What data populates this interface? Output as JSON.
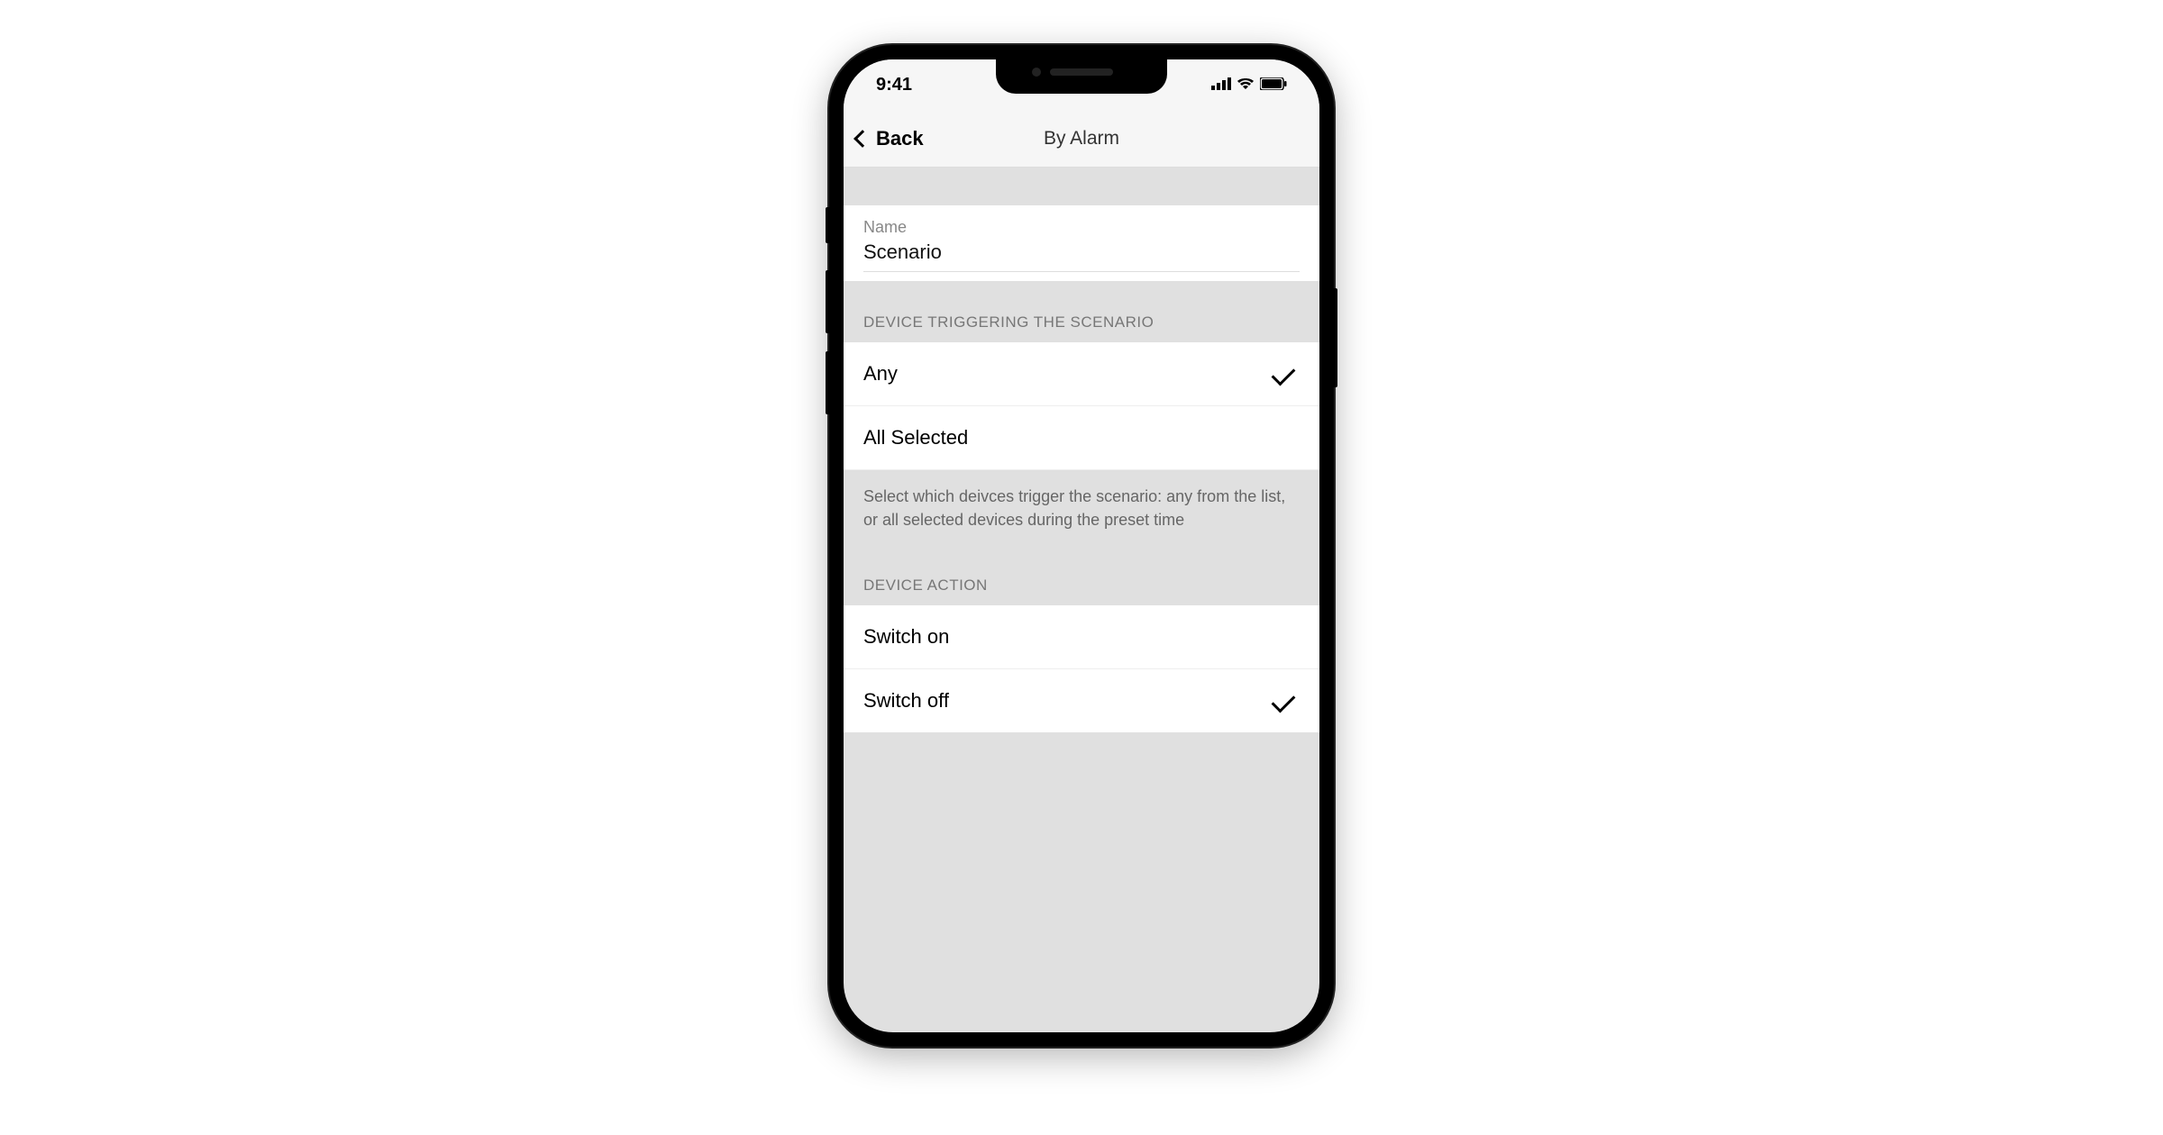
{
  "status_bar": {
    "time": "9:41"
  },
  "nav": {
    "back_label": "Back",
    "title": "By Alarm"
  },
  "name_field": {
    "label": "Name",
    "value": "Scenario"
  },
  "trigger_section": {
    "header": "DEVICE TRIGGERING THE SCENARIO",
    "options": [
      {
        "label": "Any",
        "selected": true
      },
      {
        "label": "All Selected",
        "selected": false
      }
    ],
    "footer": "Select which deivces trigger the scenario: any from the list, or all selected devices during the preset time"
  },
  "action_section": {
    "header": "DEVICE ACTION",
    "options": [
      {
        "label": "Switch on",
        "selected": false
      },
      {
        "label": "Switch off",
        "selected": true
      }
    ]
  }
}
